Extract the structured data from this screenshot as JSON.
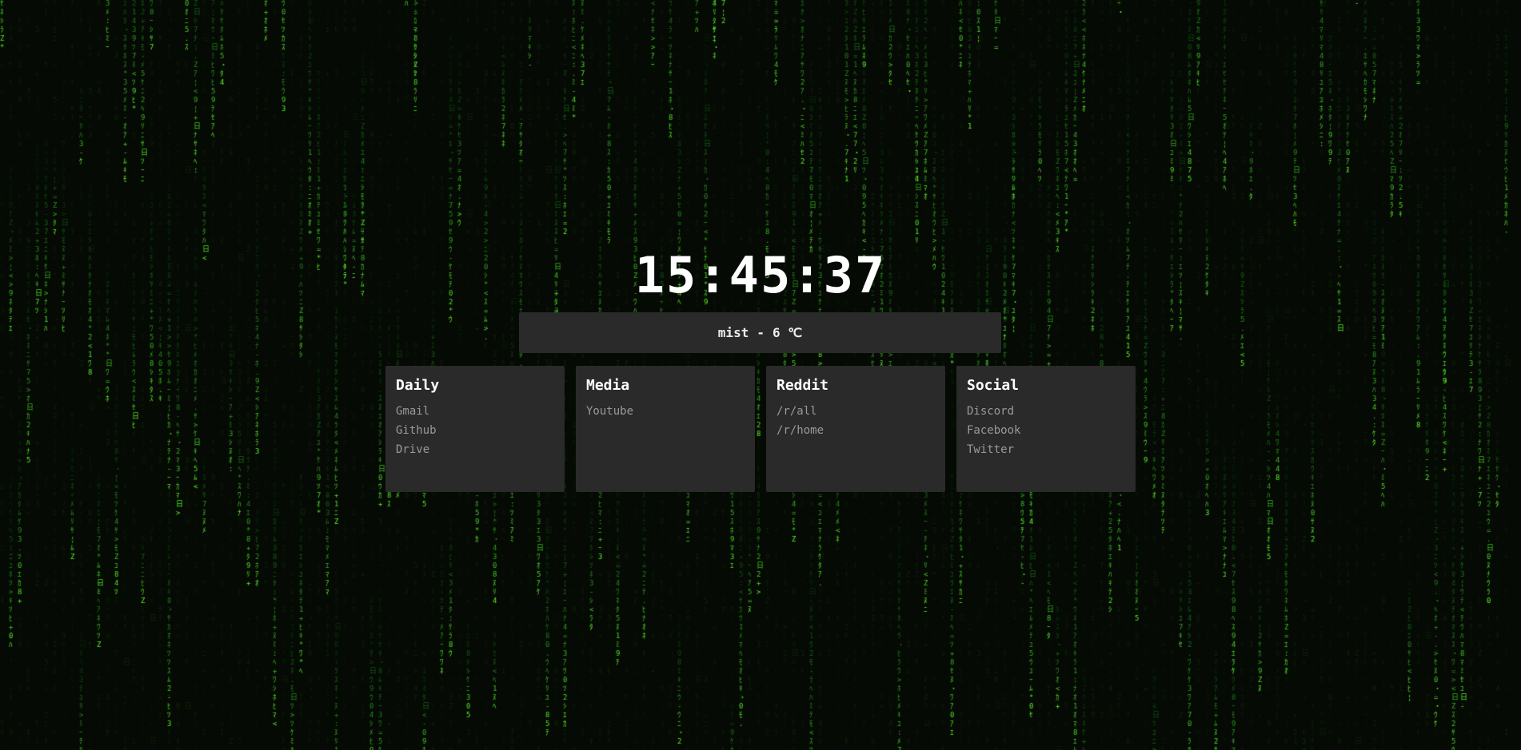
{
  "clock": {
    "time": "15:45:37"
  },
  "weather": {
    "condition": "mist",
    "separator": "-",
    "temperature": "6 ℃"
  },
  "colors": {
    "background": "#050a04",
    "rain_bright": "#7cf23a",
    "rain_dim": "#1e4a12",
    "card_bg": "#2a2a2a",
    "link": "#9a9a9a"
  },
  "cards": [
    {
      "title": "Daily",
      "links": [
        "Gmail",
        "Github",
        "Drive"
      ]
    },
    {
      "title": "Media",
      "links": [
        "Youtube"
      ]
    },
    {
      "title": "Reddit",
      "links": [
        "/r/all",
        "/r/home"
      ]
    },
    {
      "title": "Social",
      "links": [
        "Discord",
        "Facebook",
        "Twitter"
      ]
    }
  ]
}
